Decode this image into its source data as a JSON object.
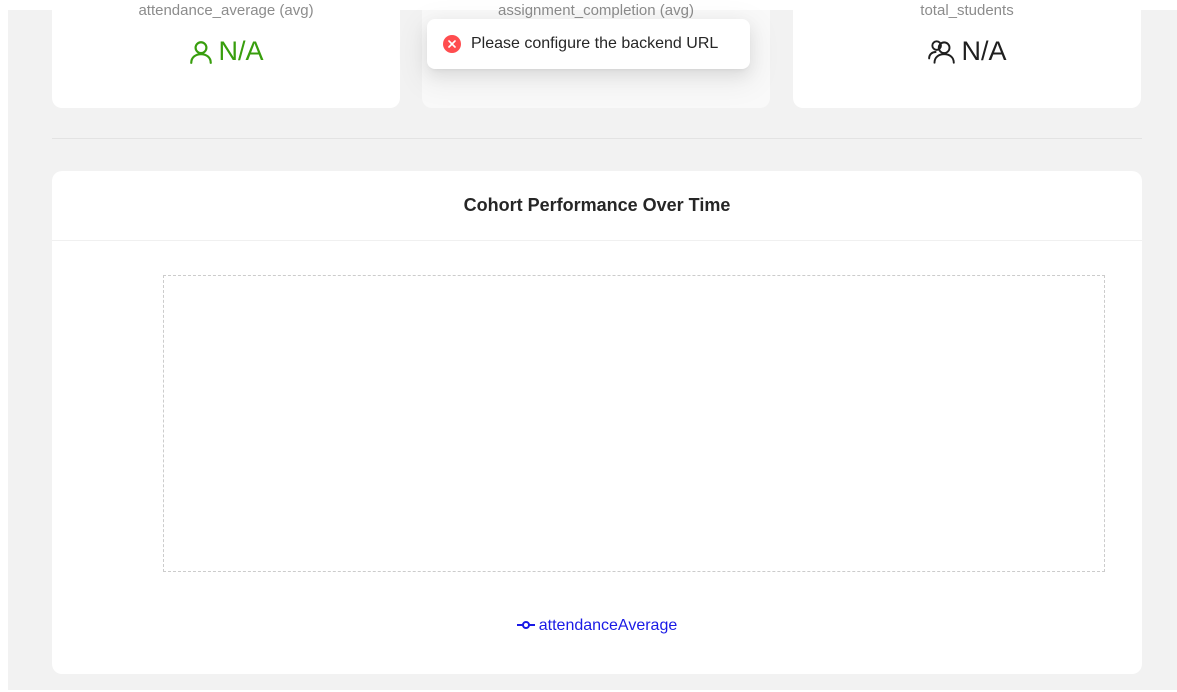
{
  "stats": [
    {
      "title": "attendance_average (avg)",
      "value": "N/A",
      "icon": "user-icon",
      "color": "#389e0d"
    },
    {
      "title": "assignment_completion (avg)",
      "value": "",
      "icon": "",
      "color": "#1f1f1f"
    },
    {
      "title": "total_students",
      "value": "N/A",
      "icon": "users-icon",
      "color": "#1f1f1f"
    }
  ],
  "toast": {
    "message": "Please configure the backend URL",
    "icon": "close-circle-icon",
    "color": "#ff4d4f"
  },
  "chart": {
    "title": "Cohort Performance Over Time",
    "legend": "attendanceAverage",
    "legend_color": "#1a1ae6"
  },
  "chart_data": {
    "type": "line",
    "title": "Cohort Performance Over Time",
    "series": [
      {
        "name": "attendanceAverage",
        "values": []
      }
    ],
    "x": [],
    "grid": true,
    "legend_position": "bottom"
  }
}
